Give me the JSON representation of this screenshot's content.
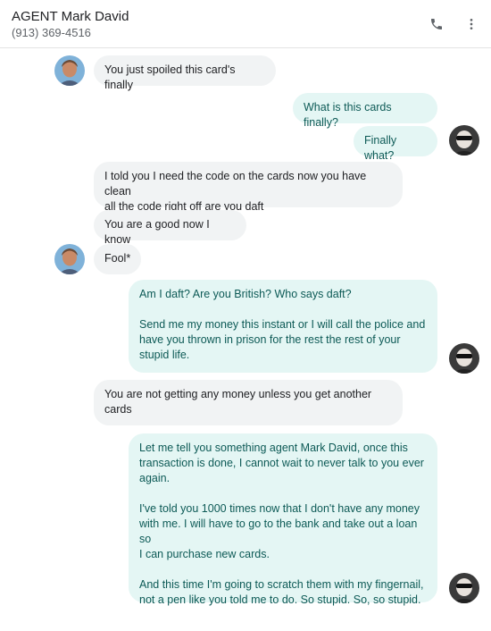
{
  "header": {
    "contact_name": "AGENT Mark David",
    "phone": "(913) 369-4516",
    "call_icon": "phone-icon",
    "menu_icon": "more-vert-icon"
  },
  "messages": [
    {
      "dir": "in",
      "text": "You just spoiled this card's finally"
    },
    {
      "dir": "out",
      "text": "What is this cards finally?"
    },
    {
      "dir": "out",
      "text": "Finally what?"
    },
    {
      "dir": "in",
      "text": "I told you I need the code on the cards now you have clean\nall the code right off are you daft"
    },
    {
      "dir": "in",
      "text": "You are a good now I know"
    },
    {
      "dir": "in",
      "text": "Fool*"
    },
    {
      "dir": "out",
      "text": "Am I daft? Are you British? Who says daft?\n\nSend me my money this instant or I will call the police and\nhave you thrown in prison for the rest the rest of your\nstupid life."
    },
    {
      "dir": "in",
      "text": "You are not getting any money unless you get another\ncards"
    },
    {
      "dir": "out",
      "text": "Let me tell you something agent Mark David, once this\ntransaction is done, I cannot wait to never talk to you ever\nagain.\n\nI've told you 1000 times now that I don't have any money\nwith me. I will have to go to the bank and take out a loan so\nI can purchase new cards.\n\nAnd this time I'm going to scratch them with my fingernail,\nnot a pen like you told me to do. So stupid. So, so stupid."
    }
  ],
  "colors": {
    "incoming_bubble": "#f1f3f4",
    "outgoing_bubble": "#e4f6f4",
    "outgoing_text": "#0d5a56"
  }
}
